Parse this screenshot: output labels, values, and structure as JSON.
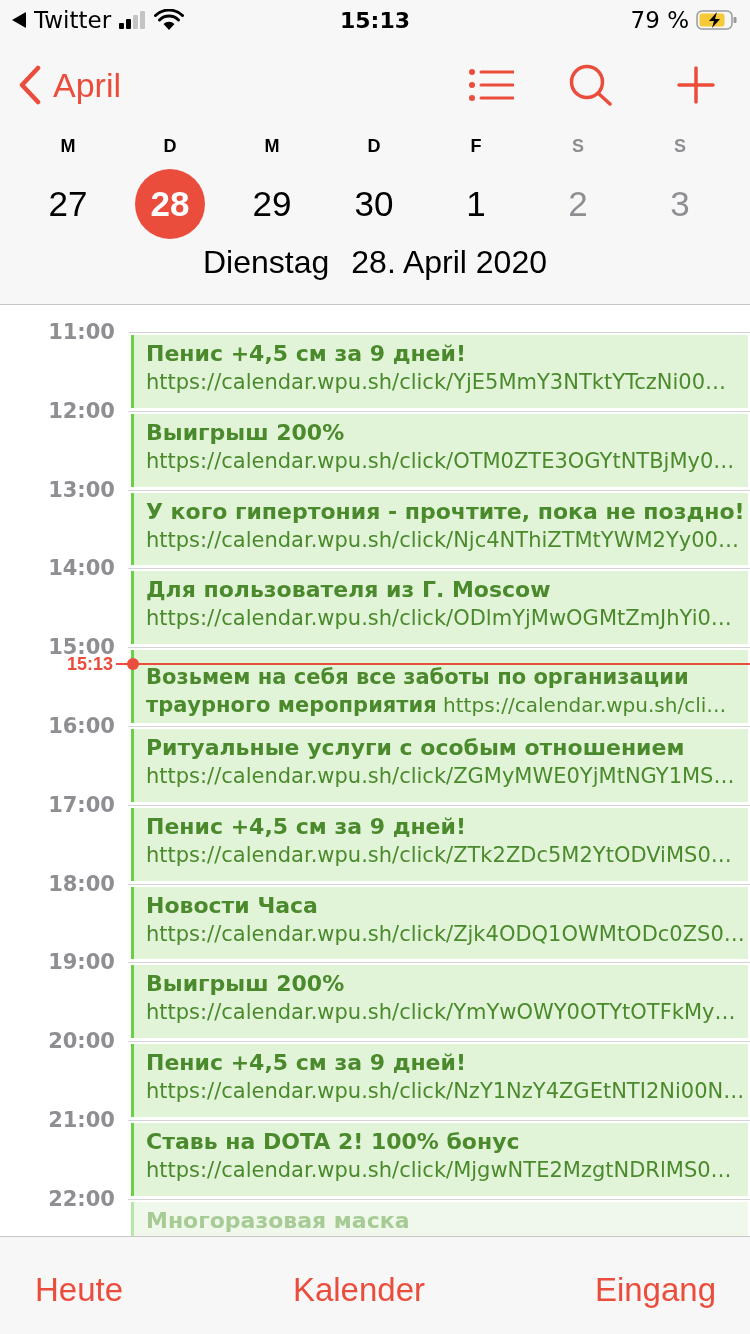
{
  "status_bar": {
    "back_app": "Twitter",
    "time": "15:13",
    "battery": "79 %"
  },
  "nav": {
    "back_label": "April"
  },
  "week": [
    {
      "letter": "M",
      "day": "27",
      "selected": false,
      "weekend": false
    },
    {
      "letter": "D",
      "day": "28",
      "selected": true,
      "weekend": false
    },
    {
      "letter": "M",
      "day": "29",
      "selected": false,
      "weekend": false
    },
    {
      "letter": "D",
      "day": "30",
      "selected": false,
      "weekend": false
    },
    {
      "letter": "F",
      "day": "1",
      "selected": false,
      "weekend": false
    },
    {
      "letter": "S",
      "day": "2",
      "selected": false,
      "weekend": true
    },
    {
      "letter": "S",
      "day": "3",
      "selected": false,
      "weekend": true
    }
  ],
  "date_heading": {
    "weekday": "Dienstag",
    "date": "28. April 2020"
  },
  "hours": [
    {
      "label": "11:00",
      "event": {
        "kind": "stacked",
        "title": "Пенис +4,5 см за 9 дней!",
        "url": "https://calendar.wpu.sh/click/YjE5MmY3NTktYTczNi00…",
        "faded": false
      }
    },
    {
      "label": "12:00",
      "event": {
        "kind": "stacked",
        "title": "Выигрыш 200%",
        "url": "https://calendar.wpu.sh/click/OTM0ZTE3OGYtNTBjMy0…",
        "faded": false
      }
    },
    {
      "label": "13:00",
      "event": {
        "kind": "stacked",
        "title": "У кого гипертония - прочтите, пока не поздно!",
        "url": "https://calendar.wpu.sh/click/Njc4NThiZTMtYWM2Yy00…",
        "faded": false
      }
    },
    {
      "label": "14:00",
      "event": {
        "kind": "stacked",
        "title": "Для пользователя из Г. Moscow",
        "url": "https://calendar.wpu.sh/click/ODlmYjMwOGMtZmJhYi0…",
        "faded": false
      }
    },
    {
      "label": "15:00",
      "now_marker": {
        "label": "15:13"
      },
      "event": {
        "kind": "inline",
        "text": "**Возьмем на себя все заботы по организации траурного мероприятия** https://calendar.wpu.sh/cli…",
        "faded": false
      }
    },
    {
      "label": "16:00",
      "event": {
        "kind": "stacked",
        "title": "Ритуальные услуги с особым отношением",
        "url": "https://calendar.wpu.sh/click/ZGMyMWE0YjMtNGY1MS…",
        "faded": false
      }
    },
    {
      "label": "17:00",
      "event": {
        "kind": "stacked",
        "title": "Пенис +4,5 см за 9 дней!",
        "url": "https://calendar.wpu.sh/click/ZTk2ZDc5M2YtODViMS0…",
        "faded": false
      }
    },
    {
      "label": "18:00",
      "event": {
        "kind": "stacked",
        "title": "Новости Часа",
        "url": "https://calendar.wpu.sh/click/Zjk4ODQ1OWMtODc0ZS0…",
        "faded": false
      }
    },
    {
      "label": "19:00",
      "event": {
        "kind": "stacked",
        "title": "Выигрыш 200%",
        "url": "https://calendar.wpu.sh/click/YmYwOWY0OTYtOTFkMy…",
        "faded": false
      }
    },
    {
      "label": "20:00",
      "event": {
        "kind": "stacked",
        "title": "Пенис +4,5 см за 9 дней!",
        "url": "https://calendar.wpu.sh/click/NzY1NzY4ZGEtNTI2Ni00N…",
        "faded": false
      }
    },
    {
      "label": "21:00",
      "event": {
        "kind": "stacked",
        "title": "Ставь на DOTA 2! 100% бонус",
        "url": "https://calendar.wpu.sh/click/MjgwNTE2MzgtNDRlMS0…",
        "faded": false
      }
    },
    {
      "label": "22:00",
      "event": {
        "kind": "stacked",
        "title": "Многоразовая маска",
        "faded": true
      }
    }
  ],
  "tab_bar": [
    "Heute",
    "Kalender",
    "Eingang"
  ]
}
